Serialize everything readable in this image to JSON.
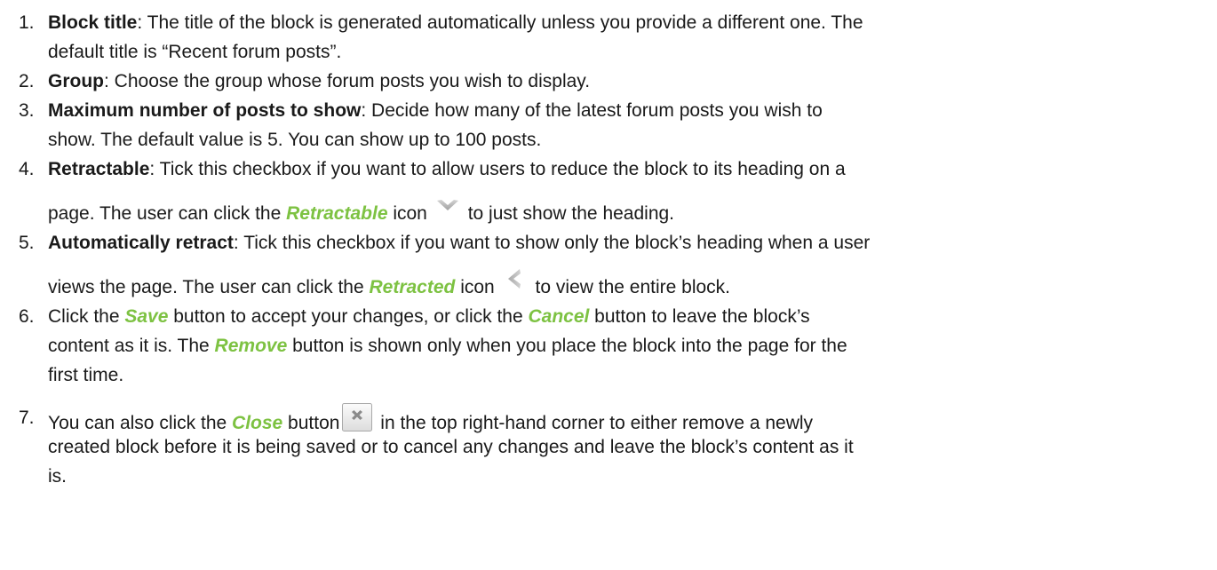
{
  "items": [
    {
      "number": "1.",
      "term": "Block title",
      "text_a": ": The title of the block is generated automatically unless you provide a different one. The",
      "text_b": "default title is “Recent forum posts”."
    },
    {
      "number": "2.",
      "term": "Group",
      "text_a": ": Choose the group whose forum posts you wish to display."
    },
    {
      "number": "3.",
      "term": "Maximum number of posts to show",
      "text_a": ": Decide how many of the latest forum posts you wish to",
      "text_b": "show. The default value is 5. You can show up to 100 posts."
    },
    {
      "number": "4.",
      "term": "Retractable",
      "text_a": ": Tick this checkbox if you want to allow users to reduce the block to its heading on a",
      "text_b1": "page. The user can click the ",
      "ui_term": "Retractable",
      "text_b2": " icon",
      "text_b3": " to just show the heading.",
      "icon": "chevron-down-icon"
    },
    {
      "number": "5.",
      "term": "Automatically retract",
      "text_a": ": Tick this checkbox if you want to show only the block’s heading when a user",
      "text_b1": "views the page. The user can click the ",
      "ui_term": "Retracted",
      "text_b2": " icon",
      "text_b3": " to view the entire block.",
      "icon": "chevron-left-icon"
    },
    {
      "number": "6.",
      "text_a1": "Click the ",
      "save_term": "Save",
      "text_a2": " button to accept your changes, or click the ",
      "cancel_term": "Cancel",
      "text_a3": " button to leave the block’s",
      "text_b1": "content as it is. The ",
      "remove_term": "Remove",
      "text_b2": " button is shown only when you place the block into the page for the",
      "text_c": "first time."
    },
    {
      "number": "7.",
      "text_a1": "You can also click the ",
      "ui_term": "Close",
      "text_a2": " button",
      "text_a3": " in the top right-hand corner to either remove a newly",
      "text_b": "created block before it is being saved or to cancel any changes and leave the block’s content as it",
      "text_c": "is.",
      "icon": "close-icon"
    }
  ],
  "colors": {
    "ui_term": "#7dc242",
    "text": "#1a1a1a",
    "icon_grey": "#b9b9b9"
  }
}
